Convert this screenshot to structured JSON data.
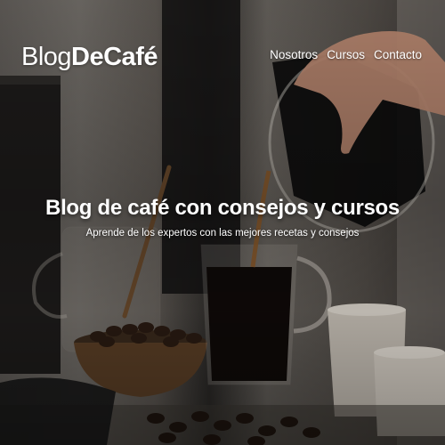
{
  "header": {
    "logo": {
      "light": "Blog",
      "bold": "DeCafé"
    },
    "nav": [
      {
        "label": "Nosotros"
      },
      {
        "label": "Cursos"
      },
      {
        "label": "Contacto"
      }
    ]
  },
  "hero": {
    "title": "Blog de café con consejos y cursos",
    "subtitle": "Aprende de los expertos con las mejores recetas y consejos"
  }
}
